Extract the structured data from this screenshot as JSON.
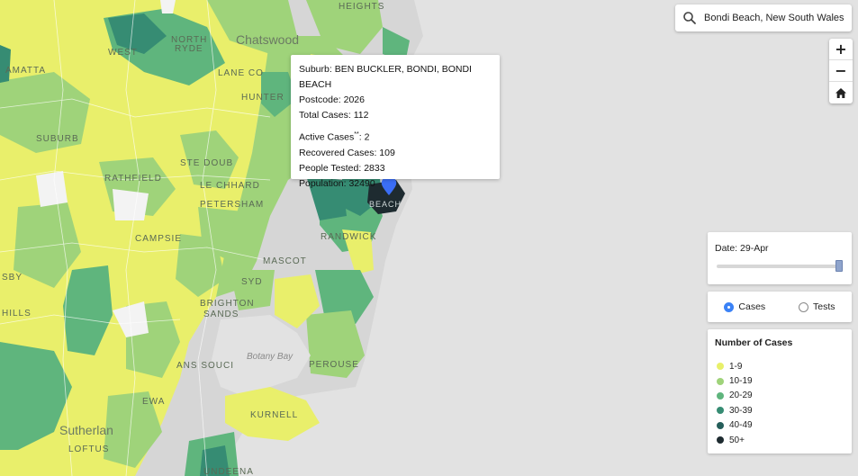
{
  "search": {
    "value": "Bondi Beach, New South Wales"
  },
  "zoom": {
    "in_label": "+",
    "out_label": "−",
    "home_icon": "home-icon"
  },
  "popup": {
    "suburb": "Suburb: BEN BUCKLER, BONDI, BONDI BEACH",
    "postcode": "Postcode: 2026",
    "total_cases": "Total Cases: 112",
    "active_cases_prefix": "Active Cases",
    "active_cases_mark": "**",
    "active_cases_suffix": ": 2",
    "recovered": "Recovered Cases: 109",
    "tested": "People Tested: 2833",
    "population": "Population: 32490"
  },
  "date_control": {
    "label": "Date: 29-Apr",
    "position": 1.0
  },
  "mode_toggle": {
    "options": [
      {
        "label": "Cases",
        "selected": true
      },
      {
        "label": "Tests",
        "selected": false
      }
    ]
  },
  "legend": {
    "title": "Number of Cases",
    "items": [
      {
        "label": "1-9",
        "color": "#e8f06a"
      },
      {
        "label": "10-19",
        "color": "#9fd37a"
      },
      {
        "label": "20-29",
        "color": "#5fb57d"
      },
      {
        "label": "30-39",
        "color": "#368c73"
      },
      {
        "label": "40-49",
        "color": "#255e5a"
      },
      {
        "label": "50+",
        "color": "#1e2b30"
      }
    ]
  },
  "map_labels": {
    "heights": "HEIGHTS",
    "north_ryde_1": "NORTH",
    "north_ryde_2": "RYDE",
    "west": "WEST",
    "chatswood": "Chatswood",
    "lane_cove": "LANE CO",
    "hunters": "HUNTER",
    "amatta": "AMATTA",
    "suburb": "SUBURB",
    "ste_doub": "STE DOUB",
    "rathfield": "RATHFIELD",
    "lichhard": "LE CHHARD",
    "petersham": "PETERSHAM",
    "campsie": "CAMPSIE",
    "randwick": "RANDWICK",
    "mascot": "MASCOT",
    "syd": "SYD",
    "brighton": "BRIGHTON",
    "sands": "SANDS",
    "botany_bay": "Botany Bay",
    "sans_souci": "ANS SOUCI",
    "perouse": "PEROUSE",
    "kurnell": "KURNELL",
    "sutherland": "Sutherlan",
    "loftus": "LOFTUS",
    "bundeena": "UNDEENA",
    "hills": "HILLS",
    "sby": "SBY",
    "ewa": "EWA",
    "beach": "BEACH"
  },
  "colors": {
    "land_gray": "#d9d9d9",
    "water": "#e2e2e2",
    "marker": "#3b6ef5"
  }
}
